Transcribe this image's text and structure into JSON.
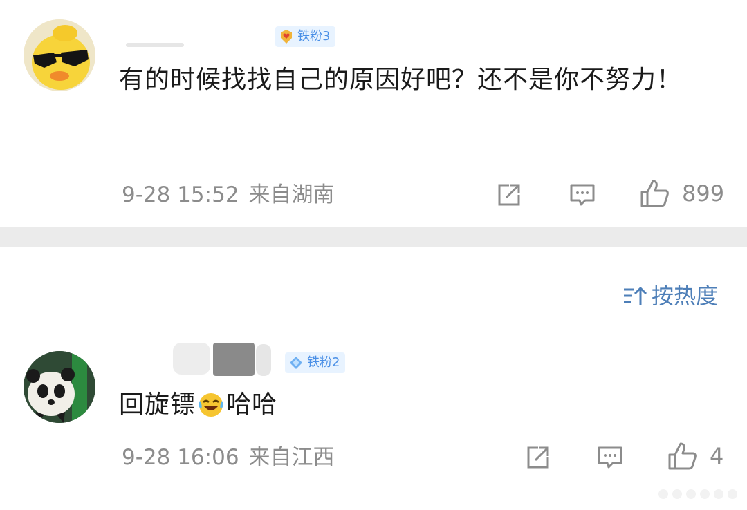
{
  "comments": [
    {
      "fan_badge": "铁粉3",
      "text": "有的时候找找自己的原因好吧？还不是你不努力！",
      "timestamp": "9-28 15:52",
      "location": "来自湖南",
      "like_count": "899",
      "avatar_icon": "duck-sunglasses-avatar",
      "badge_icon": "gold-heart-badge-icon"
    },
    {
      "fan_badge": "铁粉2",
      "text_before": "回旋镖",
      "emoji": "laughing-crying-emoji",
      "text_after": "哈哈",
      "timestamp": "9-28 16:06",
      "location": "来自江西",
      "like_count": "4",
      "avatar_icon": "panda-avatar",
      "badge_icon": "blue-diamond-badge-icon"
    }
  ],
  "sort": {
    "label": "按热度",
    "icon": "sort-icon"
  },
  "colors": {
    "badge_text": "#4a8fe6",
    "badge_bg": "#e8f3ff",
    "sort_blue": "#4e7fb8",
    "meta_gray": "#8c8c8c",
    "divider": "#ebebeb"
  }
}
